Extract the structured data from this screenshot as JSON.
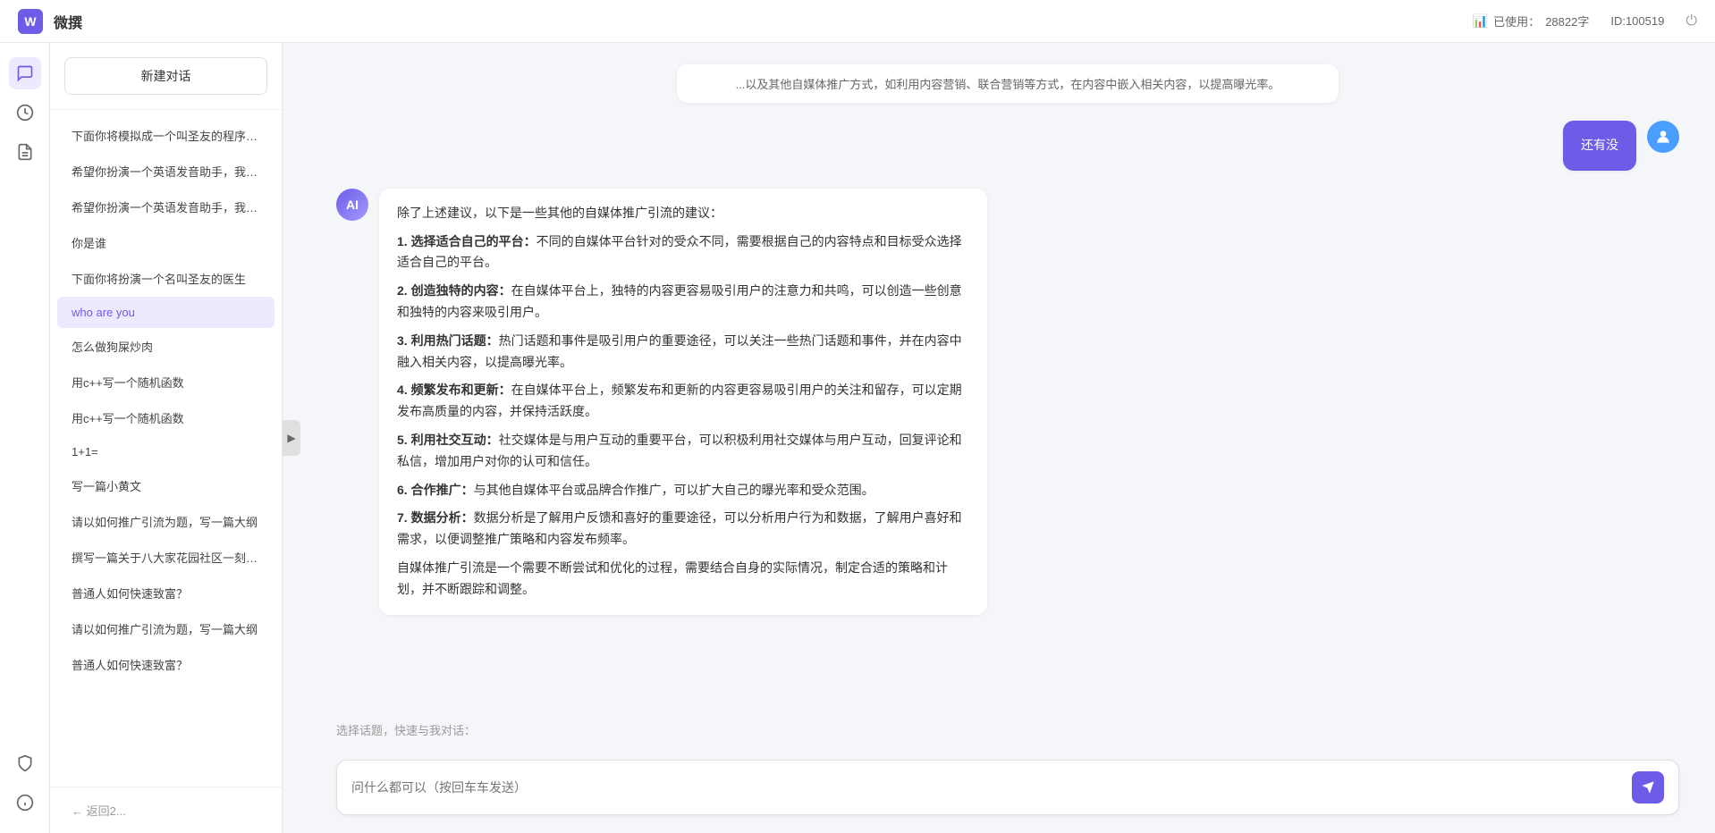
{
  "header": {
    "title": "微撰",
    "logo_text": "W",
    "usage_label": "已使用：",
    "usage_value": "28822字",
    "id_label": "ID:100519",
    "usage_icon": "📊"
  },
  "nav_icons": {
    "icon1": "◇",
    "icon2": "⏰",
    "icon3": "📋",
    "icon_shield": "🛡",
    "icon_info": "ℹ"
  },
  "sidebar": {
    "new_chat_label": "新建对话",
    "items": [
      {
        "label": "下面你将模拟成一个叫圣友的程序员，我说..."
      },
      {
        "label": "希望你扮演一个英语发音助手，我提供给你..."
      },
      {
        "label": "希望你扮演一个英语发音助手，我提供给你..."
      },
      {
        "label": "你是谁"
      },
      {
        "label": "下面你将扮演一个名叫圣友的医生"
      },
      {
        "label": "who are you",
        "active": true
      },
      {
        "label": "怎么做狗屎炒肉"
      },
      {
        "label": "用c++写一个随机函数"
      },
      {
        "label": "用c++写一个随机函数"
      },
      {
        "label": "1+1="
      },
      {
        "label": "写一篇小黄文"
      },
      {
        "label": "请以如何推广引流为题，写一篇大纲"
      },
      {
        "label": "撰写一篇关于八大家花园社区一刻钟便民生..."
      },
      {
        "label": "普通人如何快速致富？"
      },
      {
        "label": "请以如何推广引流为题，写一篇大纲"
      },
      {
        "label": "普通人如何快速致富？"
      }
    ],
    "bottom_item": "← 返回2..."
  },
  "chat": {
    "partial_message": "...以及其他自媒体推广方式，如利用内容营销、联合营销等方式，在内容中嵌入相关内容，以提高曝光率。",
    "user_message": "还有没",
    "user_avatar_symbol": "👤",
    "ai_avatar_symbol": "AI",
    "ai_response": {
      "intro": "除了上述建议，以下是一些其他的自媒体推广引流的建议：",
      "points": [
        {
          "num": "1",
          "title": "选择适合自己的平台：",
          "text": "不同的自媒体平台针对的受众不同，需要根据自己的内容特点和目标受众选择适合自己的平台。"
        },
        {
          "num": "2",
          "title": "创造独特的内容：",
          "text": "在自媒体平台上，独特的内容更容易吸引用户的注意力和共鸣，可以创造一些创意和独特的内容来吸引用户。"
        },
        {
          "num": "3",
          "title": "利用热门话题：",
          "text": "热门话题和事件是吸引用户的重要途径，可以关注一些热门话题和事件，并在内容中融入相关内容，以提高曝光率。"
        },
        {
          "num": "4",
          "title": "频繁发布和更新：",
          "text": "在自媒体平台上，频繁发布和更新的内容更容易吸引用户的关注和留存，可以定期发布高质量的内容，并保持活跃度。"
        },
        {
          "num": "5",
          "title": "利用社交互动：",
          "text": "社交媒体是与用户互动的重要平台，可以积极利用社交媒体与用户互动，回复评论和私信，增加用户对你的认可和信任。"
        },
        {
          "num": "6",
          "title": "合作推广：",
          "text": "与其他自媒体平台或品牌合作推广，可以扩大自己的曝光率和受众范围。"
        },
        {
          "num": "7",
          "title": "数据分析：",
          "text": "数据分析是了解用户反馈和喜好的重要途径，可以分析用户行为和数据，了解用户喜好和需求，以便调整推广策略和内容发布频率。"
        }
      ],
      "conclusion": "自媒体推广引流是一个需要不断尝试和优化的过程，需要结合自身的实际情况，制定合适的策略和计划，并不断跟踪和调整。"
    },
    "quick_topics_label": "选择话题，快速与我对话：",
    "input_placeholder": "问什么都可以（按回车车发送）",
    "send_btn_icon": "➤"
  }
}
